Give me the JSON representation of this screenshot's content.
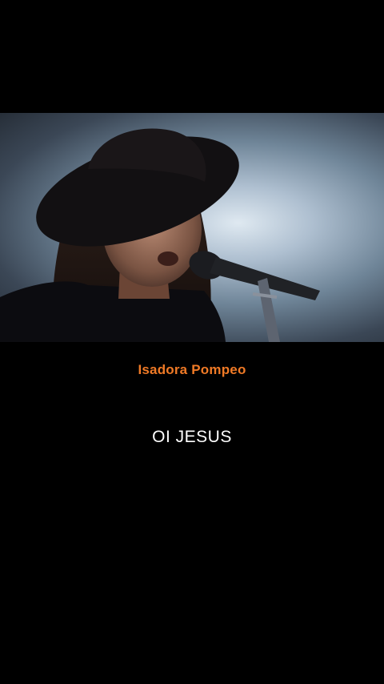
{
  "video": {
    "description_icon": "performer-video-frame"
  },
  "caption": {
    "artist": "Isadora Pompeo",
    "title": "OI JESUS"
  },
  "colors": {
    "background": "#000000",
    "artist_text": "#f07a26",
    "title_text": "#ffffff"
  }
}
